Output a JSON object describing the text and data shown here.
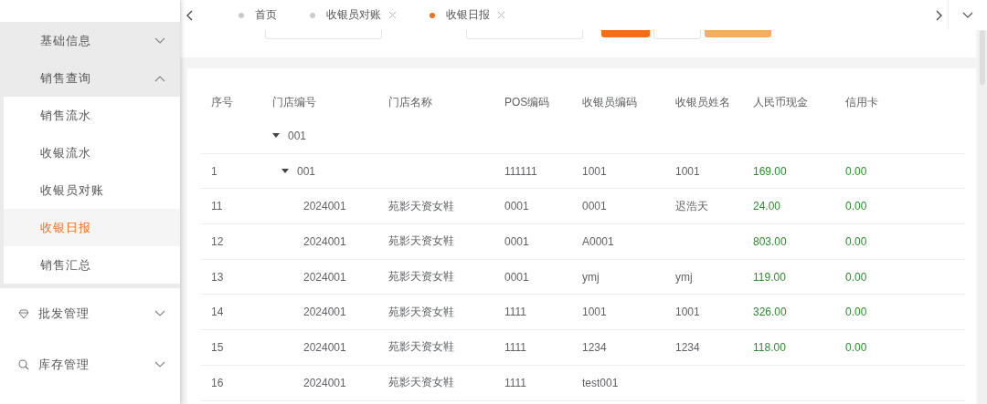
{
  "sidebar": {
    "items": [
      {
        "kind": "subgroup",
        "label": "基础信息",
        "expanded": false
      },
      {
        "kind": "subgroup",
        "label": "销售查询",
        "expanded": true,
        "children": [
          {
            "label": "销售流水",
            "selected": false
          },
          {
            "label": "收银流水",
            "selected": false
          },
          {
            "label": "收银员对账",
            "selected": false
          },
          {
            "label": "收银日报",
            "selected": true
          },
          {
            "label": "销售汇总",
            "selected": false
          }
        ]
      },
      {
        "kind": "group",
        "label": "批发管理",
        "expanded": false
      },
      {
        "kind": "group",
        "label": "库存管理",
        "expanded": false
      }
    ]
  },
  "tabs": [
    {
      "label": "首页",
      "selected": false,
      "closable": false
    },
    {
      "label": "收银员对账",
      "selected": false,
      "closable": true
    },
    {
      "label": "收银日报",
      "selected": true,
      "closable": true
    }
  ],
  "table": {
    "columns": [
      "序号",
      "门店编号",
      "门店名称",
      "POS编码",
      "收银员编码",
      "收银员姓名",
      "人民币现金",
      "信用卡"
    ],
    "rows": [
      {
        "cells": [
          "",
          "001",
          "",
          "",
          "",
          "",
          "",
          ""
        ],
        "expanded": true,
        "children": [
          {
            "cells": [
              "1",
              "001",
              "",
              "111111",
              "1001",
              "1001",
              "169.00",
              "0.00"
            ],
            "expanded": true,
            "children": [
              {
                "cells": [
                  "11",
                  "2024001",
                  "苑影天资女鞋",
                  "0001",
                  "0001",
                  "迟浩天",
                  "24.00",
                  "0.00"
                ]
              },
              {
                "cells": [
                  "12",
                  "2024001",
                  "苑影天资女鞋",
                  "0001",
                  "A0001",
                  "",
                  "803.00",
                  "0.00"
                ]
              },
              {
                "cells": [
                  "13",
                  "2024001",
                  "苑影天资女鞋",
                  "0001",
                  "ymj",
                  "ymj",
                  "119.00",
                  "0.00"
                ]
              },
              {
                "cells": [
                  "14",
                  "2024001",
                  "苑影天资女鞋",
                  "1111",
                  "1001",
                  "1001",
                  "326.00",
                  "0.00"
                ]
              },
              {
                "cells": [
                  "15",
                  "2024001",
                  "苑影天资女鞋",
                  "1111",
                  "1234",
                  "1234",
                  "118.00",
                  "0.00"
                ]
              },
              {
                "cells": [
                  "16",
                  "2024001",
                  "苑影天资女鞋",
                  "1111",
                  "test001",
                  "",
                  "",
                  ""
                ]
              }
            ]
          }
        ]
      }
    ]
  }
}
